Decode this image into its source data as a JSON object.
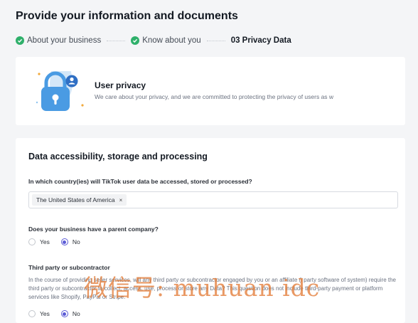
{
  "page": {
    "title": "Provide your information and documents"
  },
  "steps": [
    {
      "label": "About your business",
      "status": "done"
    },
    {
      "label": "Know about you",
      "status": "done"
    },
    {
      "label": "03 Privacy Data",
      "status": "current"
    }
  ],
  "privacy": {
    "title": "User privacy",
    "text": "We care about your privacy, and we are committed to protecting the privacy of users as w"
  },
  "data_section": {
    "title": "Data accessibility, storage and processing",
    "q1": {
      "label": "In which country(ies) will TikTok user data be accessed, stored or processed?",
      "chip": "The United States of America",
      "chip_remove": "×"
    },
    "q2": {
      "label": "Does your business have a parent company?",
      "options": [
        "Yes",
        "No"
      ],
      "selected": "No"
    },
    "q3": {
      "label": "Third party or subcontractor",
      "desc": "In the course of providing seller services, will any third party or subcontractor engaged by you or an affiliate (i party software of system) require the third party or subcontractor to collect, access, use, process or store any Data? This question does not include third-party payment or platform services like Shopify, PayPal or Stripe.",
      "options": [
        "Yes",
        "No"
      ]
    }
  },
  "watermark": "微信号: muhuan idc",
  "colors": {
    "accent": "#5b5bd6",
    "success": "#2fb06b",
    "background": "#f4f5f7"
  }
}
